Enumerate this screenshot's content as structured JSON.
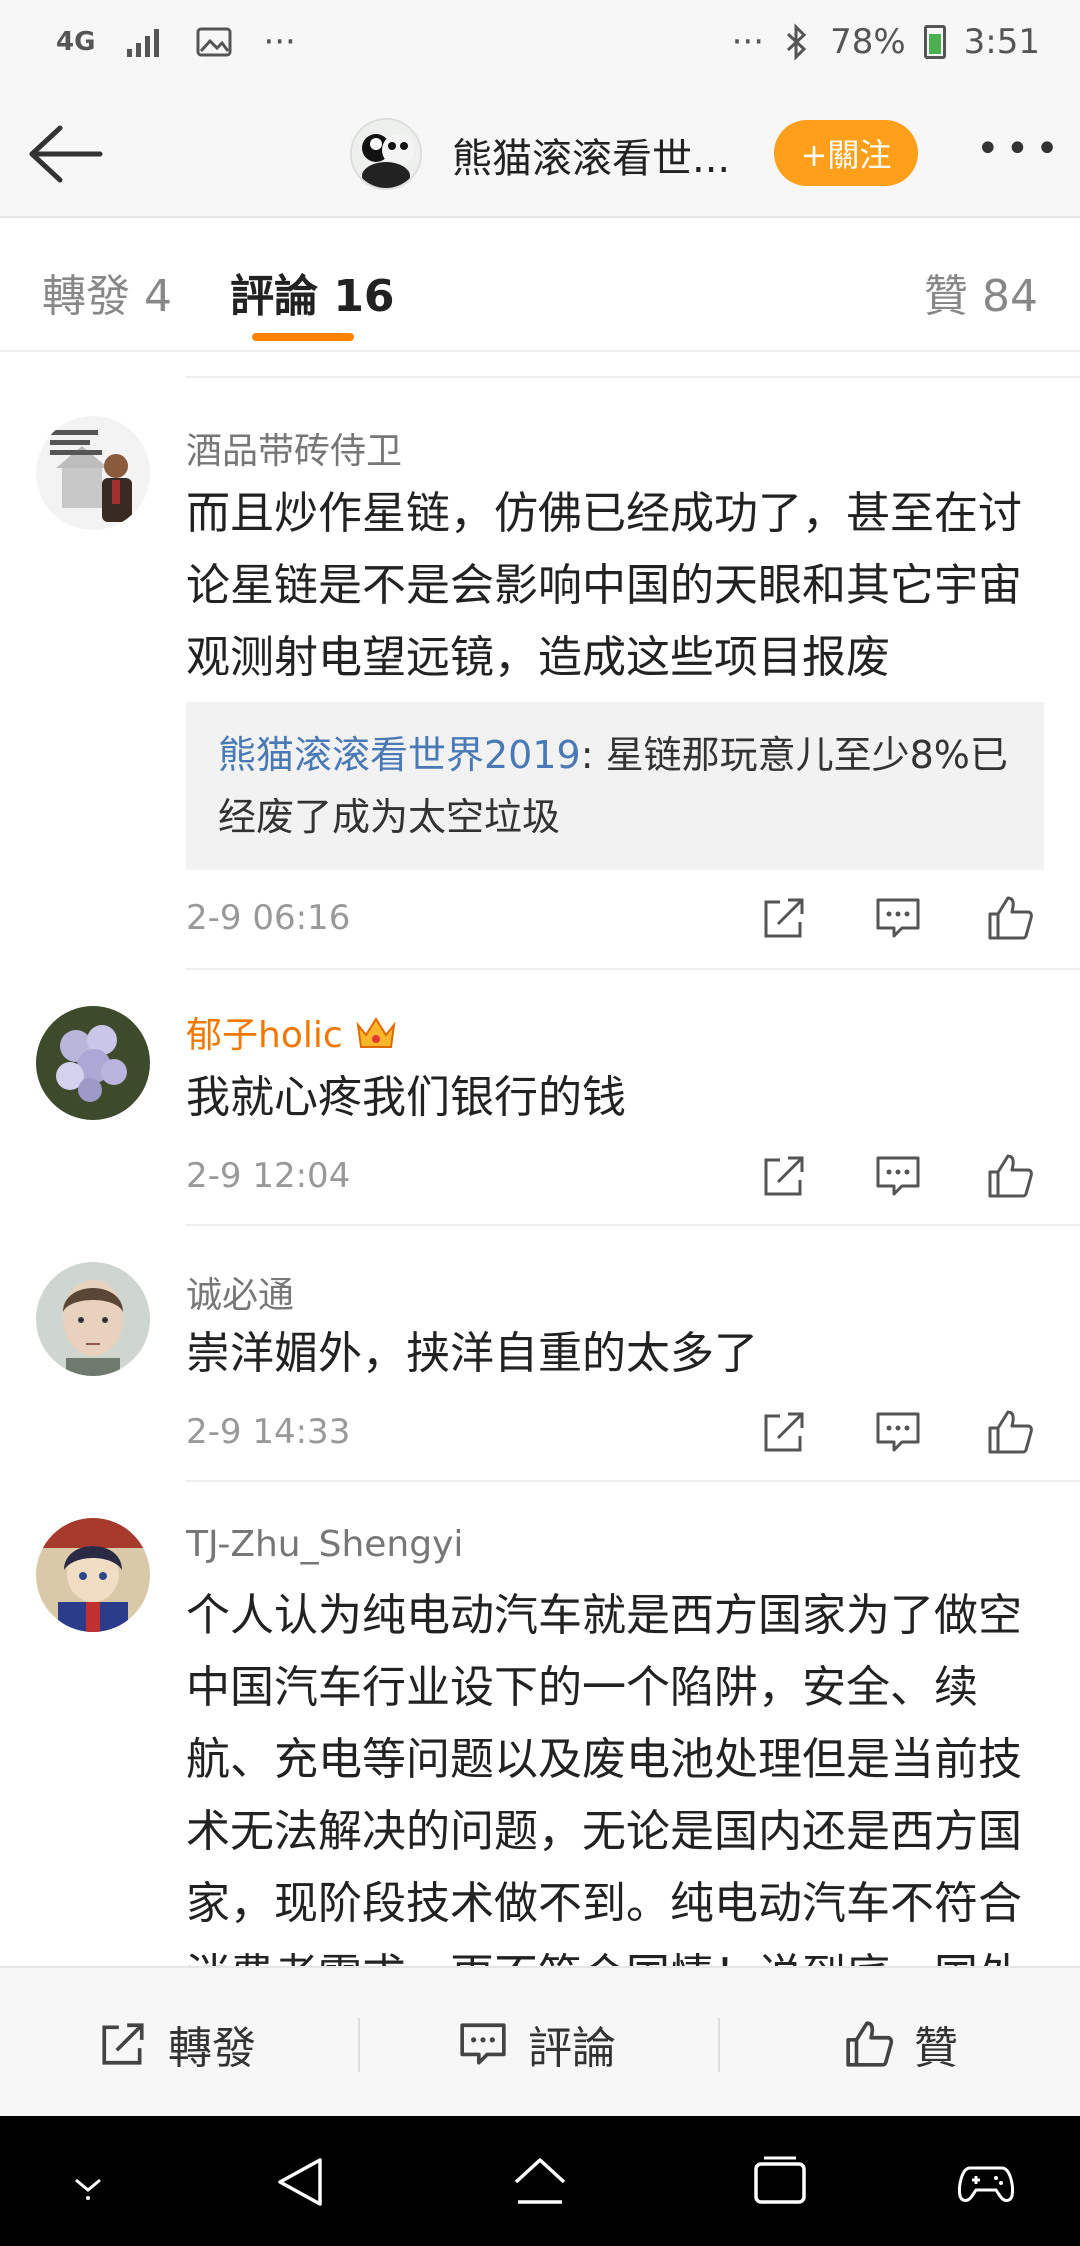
{
  "status_bar": {
    "network": "4G",
    "dots_left": "···",
    "dots_right": "···",
    "battery": "78%",
    "time": "3:51"
  },
  "header": {
    "title": "熊猫滚滚看世...",
    "follow_label": "+關注",
    "more": "•••"
  },
  "tabs": {
    "forward": "轉發 4",
    "comments": "評論 16",
    "likes": "贊 84"
  },
  "comments": [
    {
      "user": "酒品带砖侍卫",
      "text": "而且炒作星链，仿佛已经成功了，甚至在讨论星链是不是会影响中国的天眼和其它宇宙观测射电望远镜，造成这些项目报废",
      "quote_user": "熊猫滚滚看世界2019",
      "quote_text": ": 星链那玩意儿至少8%已经废了成为太空垃圾",
      "time": "2-9 06:16"
    },
    {
      "user": "郁子holic",
      "text": "我就心疼我们银行的钱",
      "time": "2-9 12:04"
    },
    {
      "user": "诚必通",
      "text": "崇洋媚外，挟洋自重的太多了",
      "time": "2-9 14:33"
    },
    {
      "user": "TJ-Zhu_Shengyi",
      "text": "个人认为纯电动汽车就是西方国家为了做空中国汽车行业设下的一个陷阱，安全、续航、充电等问题以及废电池处理但是当前技术无法解决的问题，无论是国内还是西方国家，现阶段技术做不到。纯电动汽车不符合消费者需求，更不符合国情！说到底，国外"
    }
  ],
  "bottom_bar": {
    "forward": "轉發",
    "comment": "評論",
    "like": "贊"
  },
  "colors": {
    "accent": "#ff8200",
    "follow_bg": "#ff9f1a",
    "link": "#4a7ab5",
    "vip_name": "#f07800"
  }
}
